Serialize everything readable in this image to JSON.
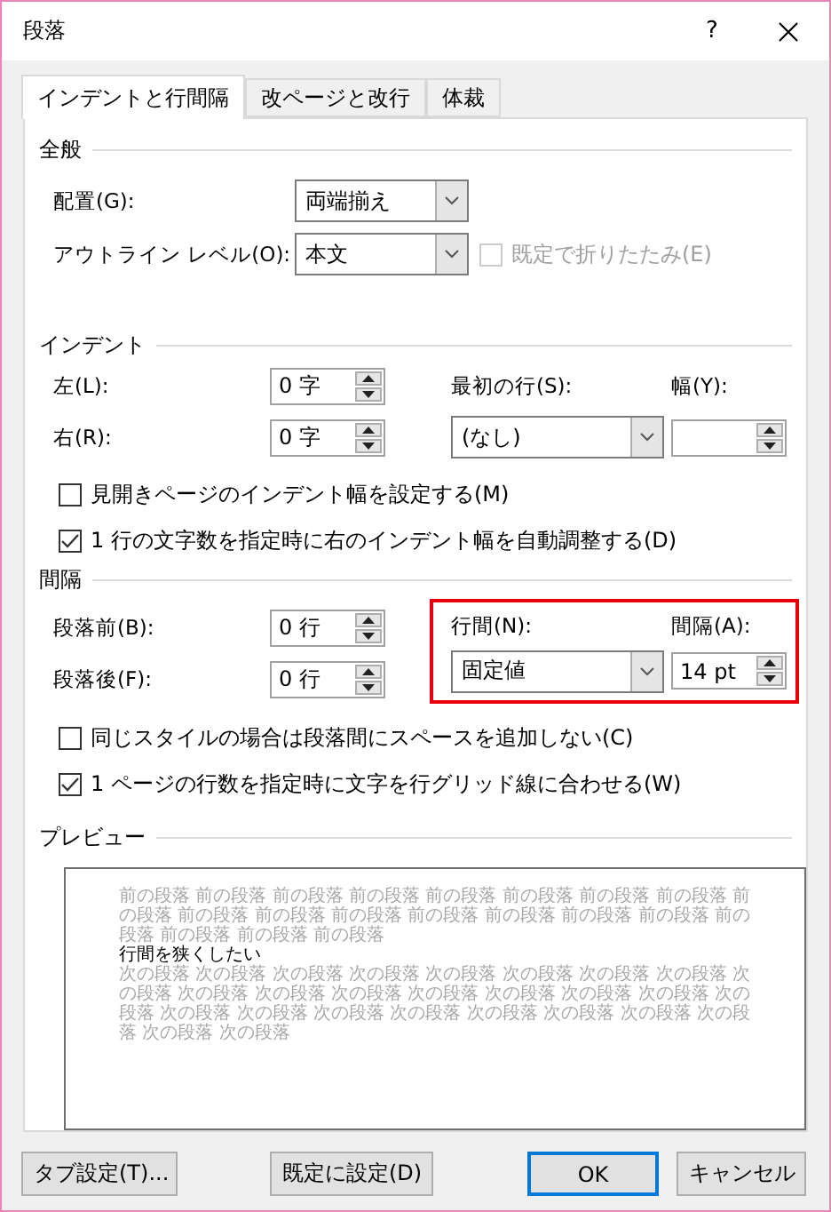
{
  "window": {
    "title": "段落",
    "help": "?"
  },
  "tabs": [
    {
      "label": "インデントと行間隔",
      "selected": true
    },
    {
      "label": "改ページと改行",
      "selected": false
    },
    {
      "label": "体裁",
      "selected": false
    }
  ],
  "general": {
    "title": "全般",
    "alignment": {
      "label": "配置(G):",
      "value": "両端揃え"
    },
    "outline_level": {
      "label": "アウトライン レベル(O):",
      "value": "本文"
    },
    "collapse": {
      "label": "既定で折りたたみ(E)",
      "checked": false,
      "disabled": true
    }
  },
  "indent": {
    "title": "インデント",
    "left": {
      "label": "左(L):",
      "value": "0 字"
    },
    "right": {
      "label": "右(R):",
      "value": "0 字"
    },
    "first_line": {
      "label": "最初の行(S):",
      "value": "(なし)"
    },
    "by": {
      "label": "幅(Y):"
    },
    "options": [
      {
        "label": "見開きページのインデント幅を設定する(M)",
        "checked": false,
        "disabled": false
      },
      {
        "label": "1 行の文字数を指定時に右のインデント幅を自動調整する(D)",
        "checked": true,
        "disabled": false
      }
    ]
  },
  "spacing": {
    "title": "間隔",
    "before": {
      "label": "段落前(B):",
      "value": "0 行"
    },
    "after": {
      "label": "段落後(F):",
      "value": "0 行"
    },
    "highlighted": true,
    "line_spacing": {
      "label": "行間(N):",
      "value": "固定値"
    },
    "at": {
      "label": "間隔(A):",
      "value": "14 pt"
    },
    "options": [
      {
        "label": "同じスタイルの場合は段落間にスペースを追加しない(C)",
        "checked": false,
        "disabled": false
      },
      {
        "label": "1 ページの行数を指定時に文字を行グリッド線に合わせる(W)",
        "checked": true,
        "disabled": false
      }
    ]
  },
  "preview": {
    "title": "プレビュー",
    "previous": "前の段落 前の段落 前の段落 前の段落 前の段落 前の段落 前の段落 前の段落 前の段落 前の段落 前の段落 前の段落 前の段落 前の段落 前の段落 前の段落 前の段落 前の段落 前の段落 前の段落",
    "sample": "行間を狭くしたい",
    "next": "次の段落 次の段落 次の段落 次の段落 次の段落 次の段落 次の段落 次の段落 次の段落 次の段落 次の段落 次の段落 次の段落 次の段落 次の段落 次の段落 次の段落 次の段落 次の段落 次の段落 次の段落 次の段落 次の段落 次の段落 次の段落 次の段落 次の段落"
  },
  "buttons": [
    {
      "label": "タブ設定(T)...",
      "default": false
    },
    {
      "label": "既定に設定(D)",
      "default": false
    },
    {
      "label": "OK",
      "default": true
    },
    {
      "label": "キャンセル",
      "default": false
    }
  ]
}
